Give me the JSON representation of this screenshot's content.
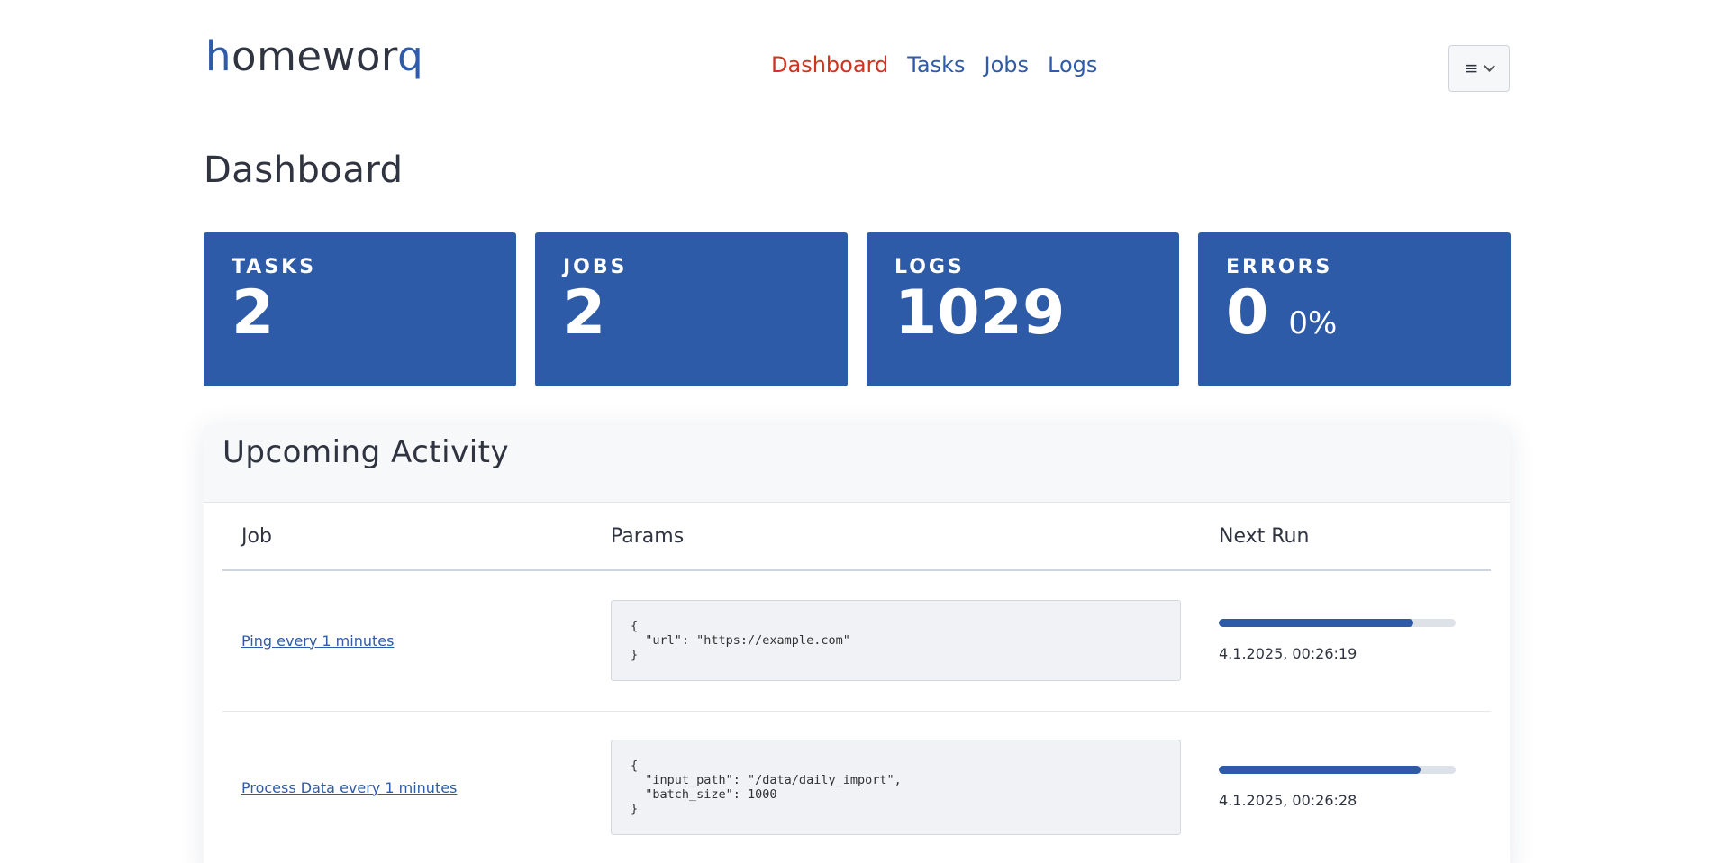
{
  "brand": {
    "logo_first": "h",
    "logo_mid": "omewor",
    "logo_last": "q"
  },
  "nav": [
    {
      "label": "Dashboard",
      "active": true
    },
    {
      "label": "Tasks",
      "active": false
    },
    {
      "label": "Jobs",
      "active": false
    },
    {
      "label": "Logs",
      "active": false
    }
  ],
  "menu": {
    "icon": "hamburger-icon",
    "bars": "≡"
  },
  "page": {
    "title": "Dashboard"
  },
  "stats": [
    {
      "label": "TASKS",
      "value": "2",
      "sub": ""
    },
    {
      "label": "JOBS",
      "value": "2",
      "sub": ""
    },
    {
      "label": "LOGS",
      "value": "1029",
      "sub": ""
    },
    {
      "label": "ERRORS",
      "value": "0",
      "sub": "0%"
    }
  ],
  "upcoming": {
    "title": "Upcoming Activity",
    "columns": [
      "Job",
      "Params",
      "Next Run"
    ],
    "rows": [
      {
        "job": "Ping every 1 minutes",
        "params": "{\n  \"url\": \"https://example.com\"\n}",
        "progress": 0.82,
        "next_run": "4.1.2025, 00:26:19"
      },
      {
        "job": "Process Data every 1 minutes",
        "params": "{\n  \"input_path\": \"/data/daily_import\",\n  \"batch_size\": 1000\n}",
        "progress": 0.85,
        "next_run": "4.1.2025, 00:26:28"
      }
    ]
  },
  "colors": {
    "primary": "#2e5ba7",
    "active_nav": "#d0341f"
  }
}
